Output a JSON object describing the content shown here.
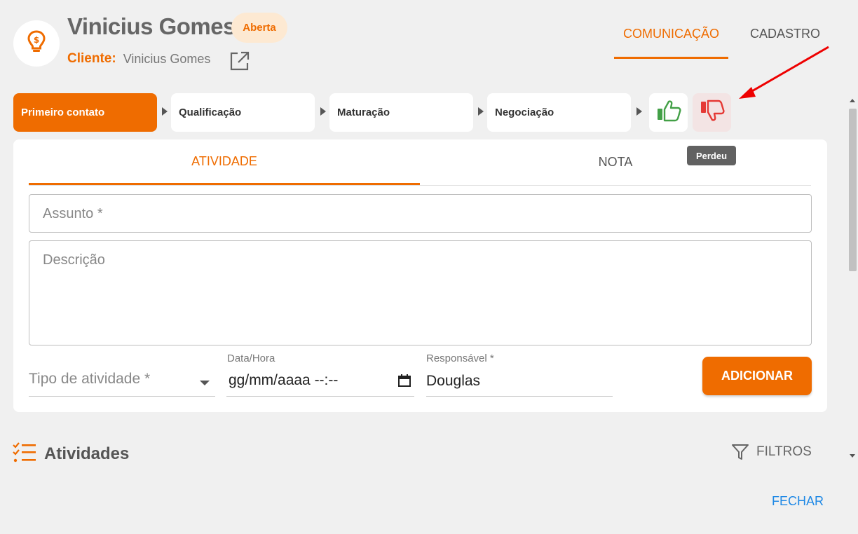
{
  "header": {
    "title": "Vinicius Gomes",
    "status_badge": "Aberta",
    "client_label": "Cliente:",
    "client_name": "Vinicius Gomes",
    "icon": "lightbulb-dollar-icon"
  },
  "top_tabs": [
    {
      "label": "COMUNICAÇÃO",
      "active": true
    },
    {
      "label": "CADASTRO",
      "active": false
    }
  ],
  "pipeline": {
    "stages": [
      {
        "label": "Primeiro contato",
        "active": true
      },
      {
        "label": "Qualificação",
        "active": false
      },
      {
        "label": "Maturação",
        "active": false
      },
      {
        "label": "Negociação",
        "active": false
      }
    ],
    "win_icon": "thumbs-up-icon",
    "lose_icon": "thumbs-down-icon",
    "lose_tooltip": "Perdeu"
  },
  "form": {
    "tabs": [
      {
        "label": "ATIVIDADE",
        "active": true
      },
      {
        "label": "NOTA",
        "active": false
      }
    ],
    "subject_placeholder": "Assunto *",
    "description_placeholder": "Descrição",
    "activity_type_placeholder": "Tipo de atividade *",
    "datetime_label": "Data/Hora",
    "datetime_value": "gg/mm/aaaa --:--",
    "responsible_label": "Responsável *",
    "responsible_value": "Douglas",
    "add_button": "ADICIONAR"
  },
  "activities": {
    "title": "Atividades",
    "filters_label": "FILTROS"
  },
  "footer": {
    "close_label": "FECHAR"
  },
  "colors": {
    "accent": "#ef6c00",
    "win": "#43a047",
    "lose": "#e53935",
    "link": "#1e88e5"
  }
}
